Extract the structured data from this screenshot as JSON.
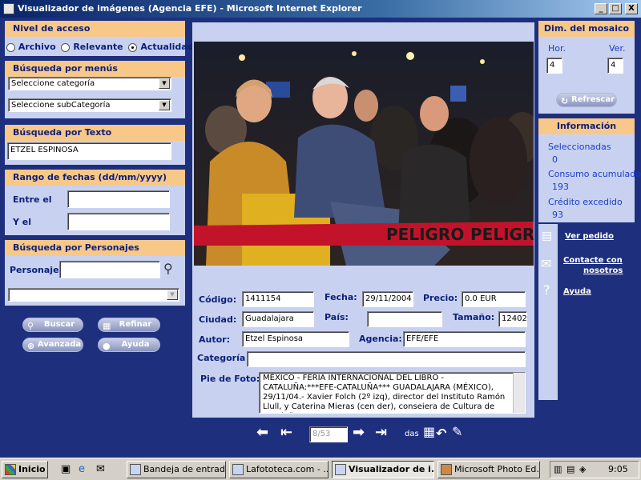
{
  "window": {
    "title": "Visualizador de imágenes (Agencia EFE) - Microsoft Internet Explorer",
    "min": "_",
    "max": "□",
    "close": "X"
  },
  "access": {
    "heading": "Nivel de acceso",
    "options": [
      "Archivo",
      "Relevante",
      "Actualidad"
    ],
    "selected": "Actualidad"
  },
  "menus": {
    "heading": "Búsqueda por menús",
    "category": "Seleccione categoría",
    "subcategory": "Seleccione subCategoría"
  },
  "text_search": {
    "heading": "Búsqueda por Texto",
    "value": "ETZEL ESPINOSA"
  },
  "dates": {
    "heading": "Rango de fechas (dd/mm/yyyy)",
    "from_label": "Entre el",
    "to_label": "Y el",
    "from": "",
    "to": ""
  },
  "people": {
    "heading": "Búsqueda por Personajes",
    "label": "Personaje",
    "value": "",
    "list": ""
  },
  "buttons": {
    "search": "Buscar",
    "refine": "Refinar",
    "advanced": "Avanzada",
    "help": "Ayuda"
  },
  "details": {
    "code_label": "Código:",
    "code": "1411154",
    "date_label": "Fecha:",
    "date": "29/11/2004",
    "price_label": "Precio:",
    "price": "0.0 EUR",
    "city_label": "Ciudad:",
    "city": "Guadalajara",
    "country_label": "País:",
    "country": "",
    "size_label": "Tamaño:",
    "size": "12402",
    "author_label": "Autor:",
    "author": "Etzel Espinosa",
    "agency_label": "Agencia:",
    "agency": "EFE/EFE",
    "category_label": "Categoría",
    "category": "",
    "caption_label": "Pie de Foto:",
    "caption": "MÉXICO - FERIA INTERNACIONAL DEL LIBRO - CATALUÑA:***EFE-CATALUÑA*** GUADALAJARA (MÉXICO), 29/11/04.- Xavier Folch (2º izq), director del Instituto Ramón Llull, y Caterina Mieras (cen der), conseiera de Cultura de Cataluña"
  },
  "photo": {
    "tape_text": "PELIGRO"
  },
  "navigation": {
    "counter": "8/53",
    "extra": "das"
  },
  "mosaic": {
    "heading": "Dim. del mosaico",
    "h_label": "Hor.",
    "v_label": "Ver.",
    "h": "4",
    "v": "4",
    "refresh": "Refrescar"
  },
  "order_info": {
    "heading": "Información pedido",
    "selected_label": "Seleccionadas",
    "selected": "0",
    "consumption_label": "Consumo acumulado",
    "consumption": "193",
    "credit_label": "Crédito excedido",
    "credit": "93"
  },
  "links": {
    "order": "Ver pedido",
    "contact_1": "Contacte con",
    "contact_2": "nosotros",
    "help": "Ayuda"
  },
  "taskbar": {
    "start": "Inicio",
    "items": [
      "Bandeja de entrad...",
      "Lafototeca.com - ...",
      "Visualizador de i...",
      "Microsoft Photo Ed..."
    ],
    "clock": "9:05"
  },
  "colors": {
    "panel": "#c8d2f0",
    "heading": "#f8c888",
    "frame": "#1e2f7d",
    "label": "#0b1f7a"
  }
}
